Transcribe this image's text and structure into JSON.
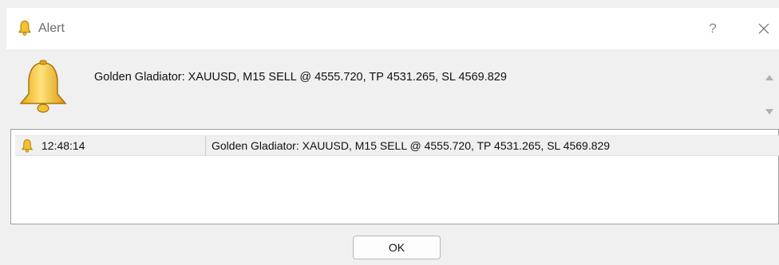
{
  "window": {
    "title": "Alert",
    "help_label": "?",
    "icons": {
      "title": "bell-icon",
      "close": "close-icon"
    }
  },
  "message": {
    "text": "Golden Gladiator: XAUUSD, M15  SELL @ 4555.720, TP 4531.265, SL 4569.829",
    "icon": "bell-icon"
  },
  "alert_list": {
    "rows": [
      {
        "icon": "bell-icon",
        "time": "12:48:14",
        "message": "Golden Gladiator: XAUUSD, M15  SELL @ 4555.720, TP 4531.265, SL 4569.829"
      }
    ]
  },
  "buttons": {
    "ok_label": "OK"
  },
  "colors": {
    "bell_gold": "#f2c233",
    "bell_outline": "#b8860b",
    "background": "#f0f0f0"
  }
}
